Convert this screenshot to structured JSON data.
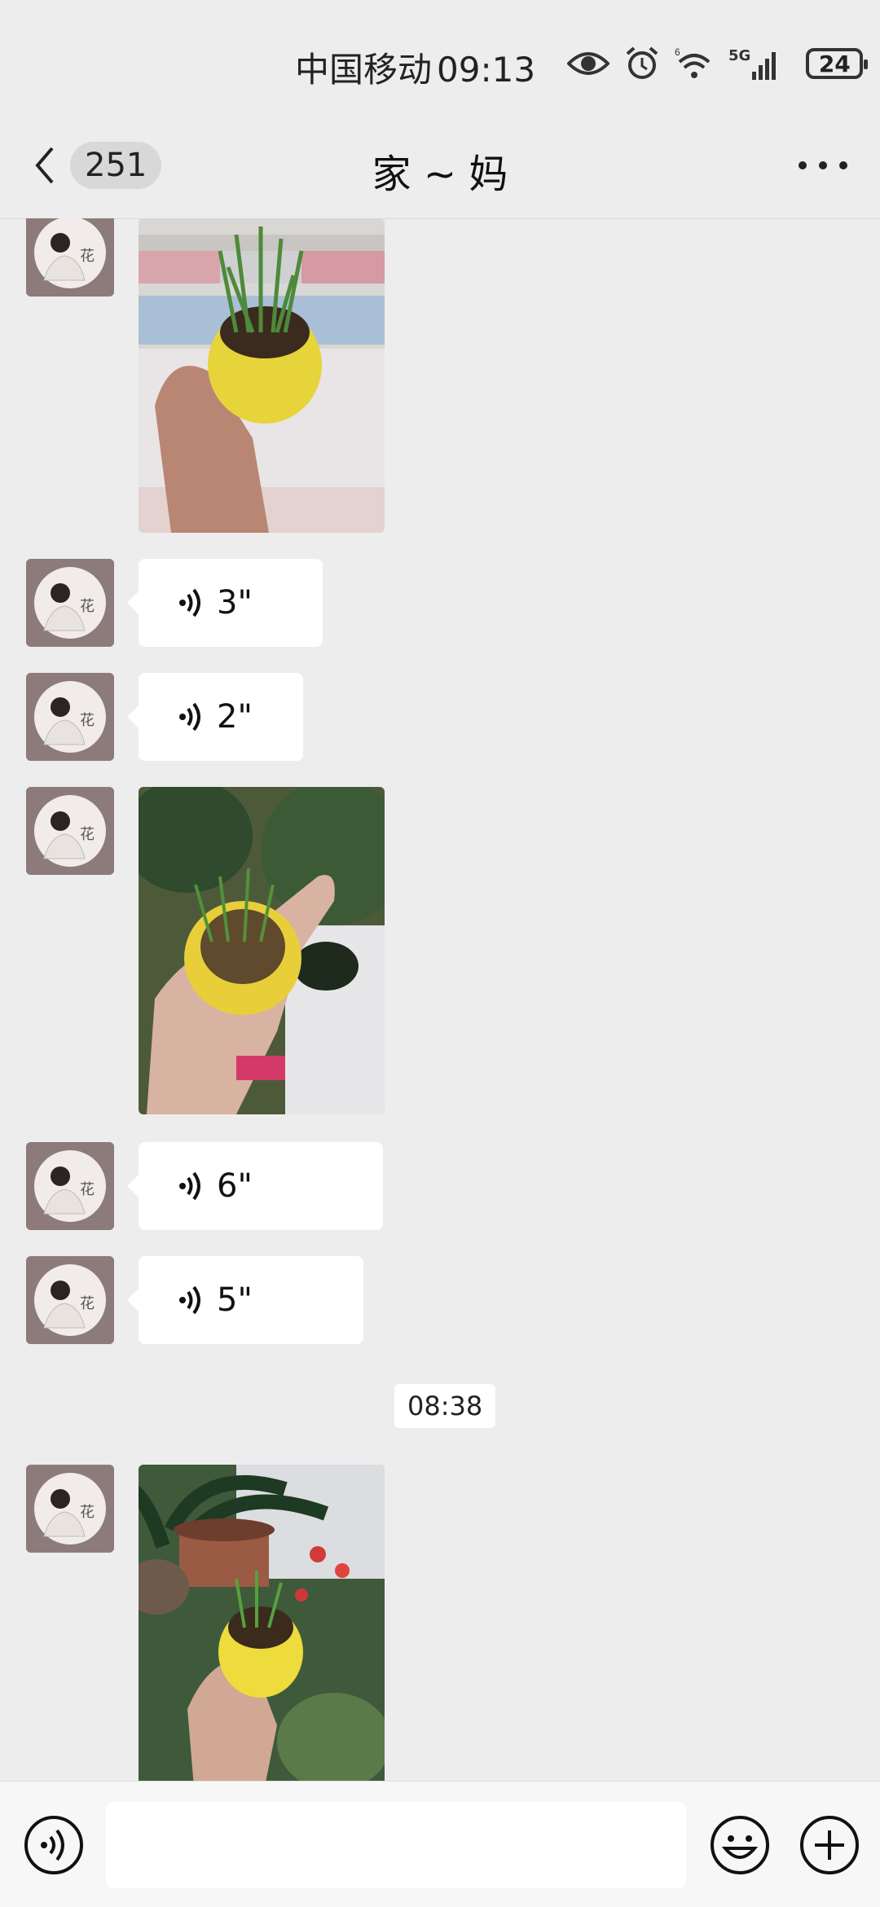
{
  "status_bar": {
    "carrier": "中国移动",
    "time": "09:13",
    "signal_label": "5G",
    "battery": "24"
  },
  "header": {
    "back_count": "251",
    "title": "家 ~ 妈"
  },
  "messages": [
    {
      "type": "image",
      "desc": "photo-plant-yellow-pot-tiles"
    },
    {
      "type": "voice",
      "duration": "3\""
    },
    {
      "type": "voice",
      "duration": "2\""
    },
    {
      "type": "image",
      "desc": "photo-plant-yellow-pot-hand"
    },
    {
      "type": "voice",
      "duration": "6\""
    },
    {
      "type": "voice",
      "duration": "5\""
    },
    {
      "type": "timestamp",
      "text": "08:38"
    },
    {
      "type": "image",
      "desc": "photo-plant-yellow-pot-window"
    }
  ],
  "avatar_text": "花",
  "input": {
    "placeholder": "",
    "value": ""
  },
  "colors": {
    "background": "#ededed",
    "bubble": "#ffffff",
    "accent": "#07c160"
  }
}
